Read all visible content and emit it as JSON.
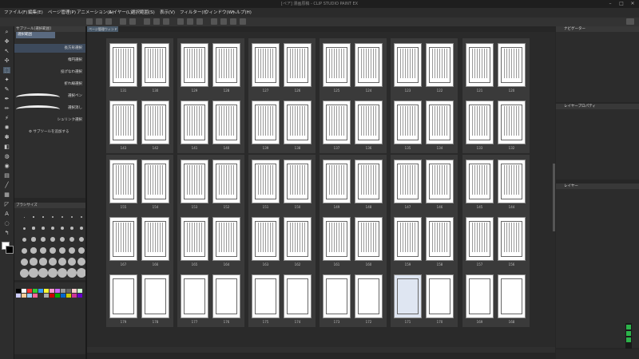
{
  "app": {
    "title": "[ペア] 漫画原稿 - CLIP STUDIO PAINT EX",
    "window_controls": [
      "–",
      "□",
      "✕"
    ]
  },
  "menu": [
    "ファイル(F)",
    "編集(E)",
    "ページ管理(P)",
    "アニメーション(A)",
    "レイヤー(L)",
    "選択範囲(S)",
    "表示(V)",
    "フィルター(I)",
    "ウィンドウ(W)",
    "ヘルプ(H)"
  ],
  "subtool_panel": {
    "header": "サブツール[選択範囲]",
    "group": "選択範囲",
    "items": [
      "長方形選択",
      "楕円選択",
      "投げなわ選択",
      "折れ線選択",
      "選択ペン",
      "選択消し",
      "シュリンク選択"
    ],
    "add_label": "サブツールを追加する"
  },
  "brush_panel": {
    "header": "ブラシサイズ"
  },
  "document_tab": {
    "label": "ページ管理ウィンドウ"
  },
  "spreads": [
    [
      [
        "131",
        "130"
      ],
      [
        "129",
        "128"
      ],
      [
        "127",
        "126"
      ],
      [
        "125",
        "124"
      ],
      [
        "123",
        "122"
      ],
      [
        "121",
        "120"
      ]
    ],
    [
      [
        "143",
        "142"
      ],
      [
        "141",
        "140"
      ],
      [
        "139",
        "138"
      ],
      [
        "137",
        "136"
      ],
      [
        "135",
        "134"
      ],
      [
        "133",
        "132"
      ]
    ],
    [
      [
        "155",
        "154"
      ],
      [
        "153",
        "152"
      ],
      [
        "151",
        "150"
      ],
      [
        "149",
        "148"
      ],
      [
        "147",
        "146"
      ],
      [
        "145",
        "144"
      ]
    ],
    [
      [
        "167",
        "166"
      ],
      [
        "165",
        "164"
      ],
      [
        "163",
        "162"
      ],
      [
        "161",
        "160"
      ],
      [
        "159",
        "158"
      ],
      [
        "157",
        "156"
      ]
    ],
    [
      [
        "179",
        "178"
      ],
      [
        "177",
        "176"
      ],
      [
        "175",
        "174"
      ],
      [
        "173",
        "172"
      ],
      [
        "171",
        "170"
      ],
      [
        "169",
        "168"
      ]
    ]
  ],
  "right_panels": {
    "navigator": "ナビゲーター",
    "layer_property": "レイヤープロパティ",
    "layer": "レイヤー"
  },
  "colors": {
    "selected_page": "#dfe6f2",
    "accent": "#4a5a6a",
    "green": "#2cb34a"
  }
}
